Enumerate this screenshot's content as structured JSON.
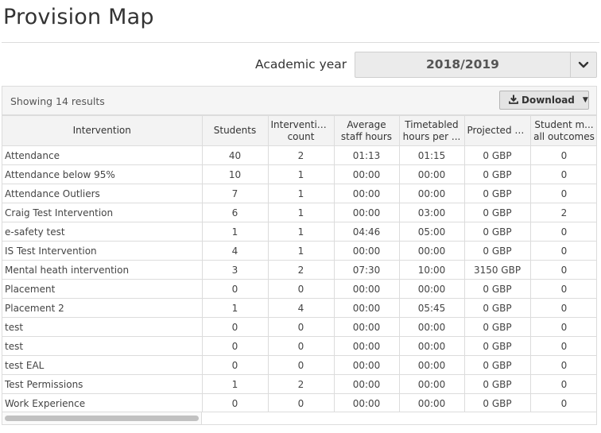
{
  "page": {
    "title": "Provision Map"
  },
  "filter": {
    "academic_year_label": "Academic year",
    "academic_year_value": "2018/2019"
  },
  "toolbar": {
    "results_text": "Showing 14 results",
    "download_label": "Download"
  },
  "table": {
    "headers": [
      [
        "Intervention"
      ],
      [
        "Students"
      ],
      [
        "Interventio...",
        "count"
      ],
      [
        "Average",
        "staff hours"
      ],
      [
        "Timetabled",
        "hours per ..."
      ],
      [
        "Projected c..."
      ],
      [
        "Student m...",
        "all outcomes"
      ]
    ],
    "rows": [
      [
        "Attendance",
        "40",
        "2",
        "01:13",
        "01:15",
        "0 GBP",
        "0"
      ],
      [
        "Attendance below 95%",
        "10",
        "1",
        "00:00",
        "00:00",
        "0 GBP",
        "0"
      ],
      [
        "Attendance Outliers",
        "7",
        "1",
        "00:00",
        "00:00",
        "0 GBP",
        "0"
      ],
      [
        "Craig Test Intervention",
        "6",
        "1",
        "00:00",
        "03:00",
        "0 GBP",
        "2"
      ],
      [
        "e-safety test",
        "1",
        "1",
        "04:46",
        "05:00",
        "0 GBP",
        "0"
      ],
      [
        "IS Test Intervention",
        "4",
        "1",
        "00:00",
        "00:00",
        "0 GBP",
        "0"
      ],
      [
        "Mental heath intervention",
        "3",
        "2",
        "07:30",
        "10:00",
        "3150 GBP",
        "0"
      ],
      [
        "Placement",
        "0",
        "0",
        "00:00",
        "00:00",
        "0 GBP",
        "0"
      ],
      [
        "Placement 2",
        "1",
        "4",
        "00:00",
        "05:45",
        "0 GBP",
        "0"
      ],
      [
        "test",
        "0",
        "0",
        "00:00",
        "00:00",
        "0 GBP",
        "0"
      ],
      [
        "test",
        "0",
        "0",
        "00:00",
        "00:00",
        "0 GBP",
        "0"
      ],
      [
        "test EAL",
        "0",
        "0",
        "00:00",
        "00:00",
        "0 GBP",
        "0"
      ],
      [
        "Test Permissions",
        "1",
        "2",
        "00:00",
        "00:00",
        "0 GBP",
        "0"
      ],
      [
        "Work Experience",
        "0",
        "0",
        "00:00",
        "00:00",
        "0 GBP",
        "0"
      ]
    ]
  },
  "icons": {
    "select_caret": "chevron-down-icon",
    "download": "download-icon",
    "download_caret": "caret-down-icon"
  }
}
